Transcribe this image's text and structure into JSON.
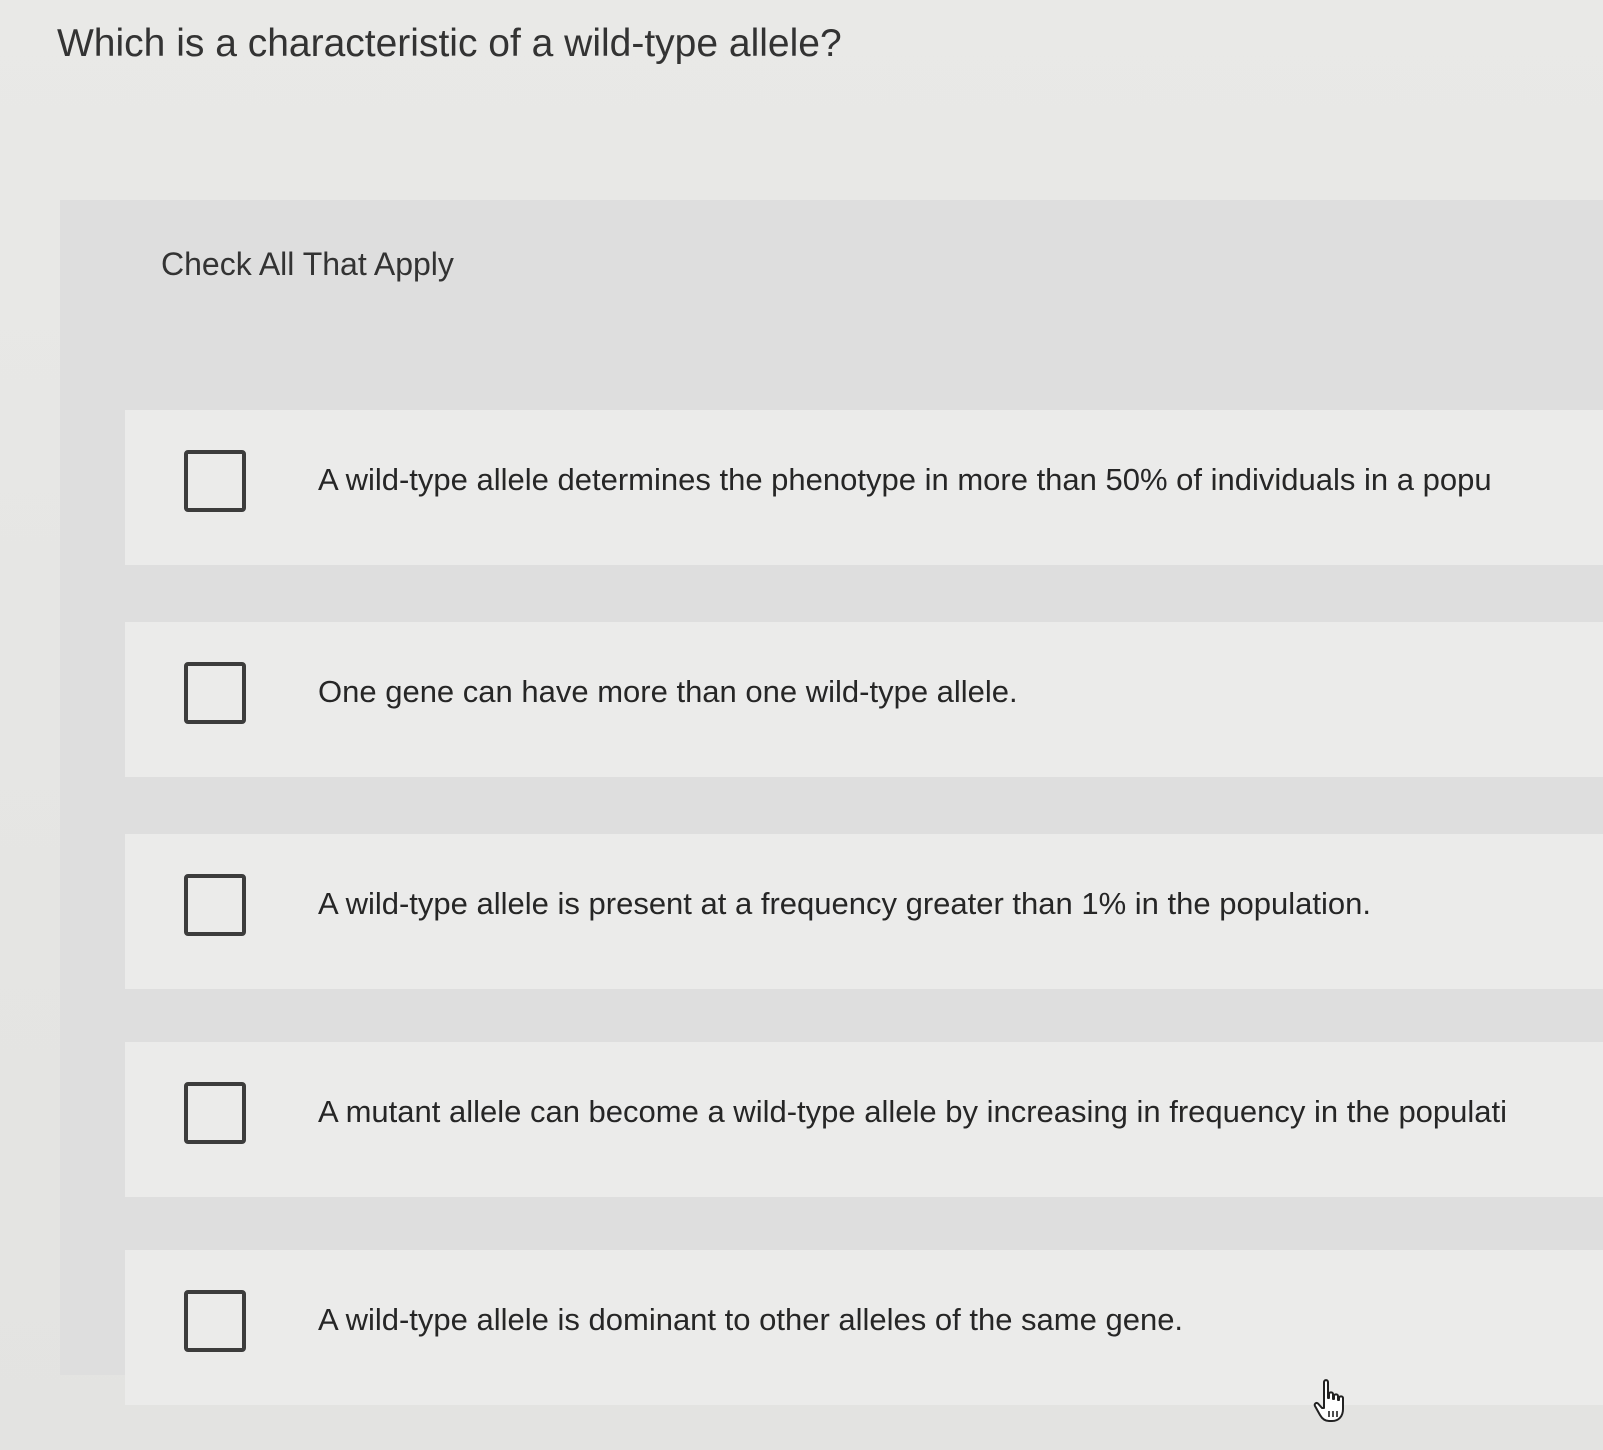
{
  "question": {
    "text": "Which is a characteristic of a wild-type allele?"
  },
  "instruction": "Check All That Apply",
  "choices": [
    {
      "label": "A wild-type allele determines the phenotype in more than 50% of individuals in a popu",
      "checked": false
    },
    {
      "label": "One gene can have more than one wild-type allele.",
      "checked": false
    },
    {
      "label": "A wild-type allele is present at a frequency greater than 1% in the population.",
      "checked": false
    },
    {
      "label": "A mutant allele can become a wild-type allele by increasing in frequency in the populati",
      "checked": false
    },
    {
      "label": "A wild-type allele is dominant to other alleles of the same gene.",
      "checked": false
    }
  ],
  "icons": {
    "checkbox": "checkbox-unchecked-icon",
    "cursor": "hand-pointer-icon"
  }
}
